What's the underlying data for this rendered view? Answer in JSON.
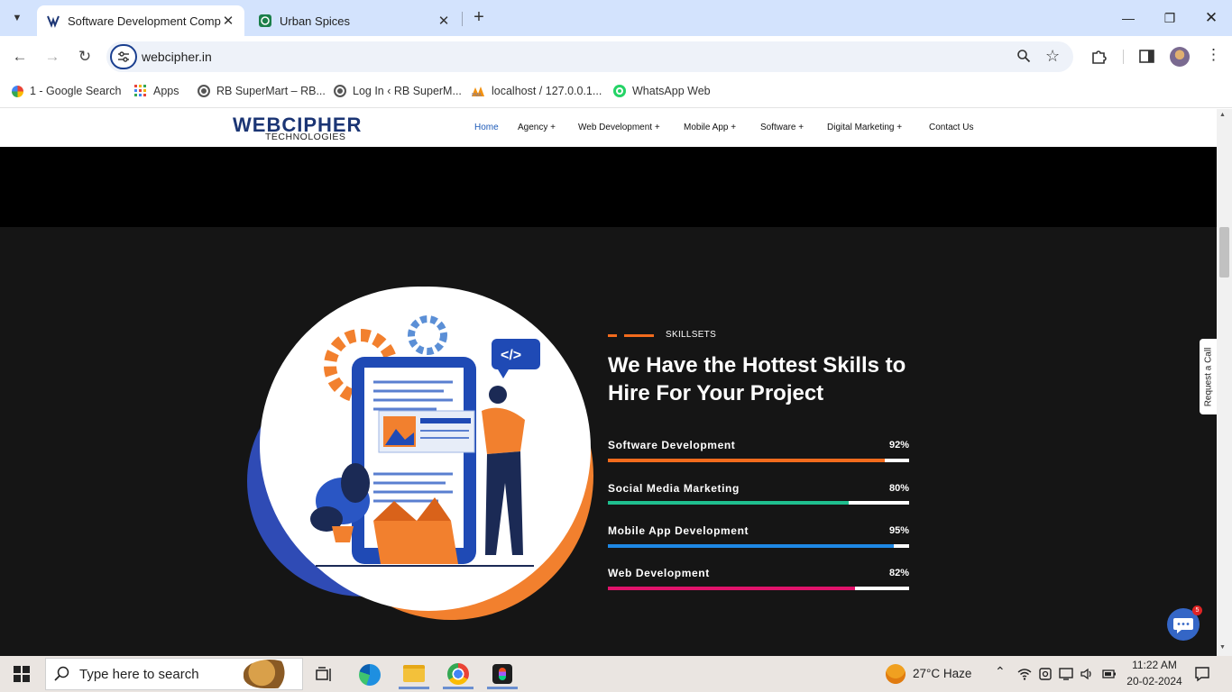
{
  "browser": {
    "tabs": [
      {
        "title": "Software Development Compar",
        "active": true,
        "favicon": "webcipher-favicon"
      },
      {
        "title": "Urban Spices",
        "active": false,
        "favicon": "urban-spices-favicon"
      }
    ],
    "url": "webcipher.in",
    "bookmarks": [
      {
        "label": "1 - Google Search",
        "icon": "google-icon"
      },
      {
        "label": "Apps",
        "icon": "apps-grid-icon"
      },
      {
        "label": "RB SuperMart – RB...",
        "icon": "globe-icon"
      },
      {
        "label": "Log In ‹ RB SuperM...",
        "icon": "globe-icon"
      },
      {
        "label": "localhost / 127.0.0.1...",
        "icon": "phpmyadmin-icon"
      },
      {
        "label": "WhatsApp Web",
        "icon": "whatsapp-icon"
      }
    ]
  },
  "site": {
    "logo_main": "WEBCIPHER",
    "logo_sub": "TECHNOLOGIES",
    "nav": [
      {
        "label": "Home",
        "active": true
      },
      {
        "label": "Agency +"
      },
      {
        "label": "Web Development +"
      },
      {
        "label": "Mobile App +"
      },
      {
        "label": "Software +"
      },
      {
        "label": "Digital Marketing +"
      },
      {
        "label": "Contact Us"
      }
    ],
    "section": {
      "kicker": "SKILLSETS",
      "headline": "We Have the Hottest Skills to Hire For Your Project",
      "skills": [
        {
          "name": "Software Development",
          "pct": "92%",
          "value": 0.92,
          "color": "#f26b1d"
        },
        {
          "name": "Social Media Marketing",
          "pct": "80%",
          "value": 0.8,
          "color": "#1fbf8f"
        },
        {
          "name": "Mobile App Development",
          "pct": "95%",
          "value": 0.95,
          "color": "#1e88e5"
        },
        {
          "name": "Web Development",
          "pct": "82%",
          "value": 0.82,
          "color": "#e0136b"
        }
      ]
    },
    "request_call": "Request a Call",
    "chat_badge": "5"
  },
  "taskbar": {
    "search_placeholder": "Type here to search",
    "weather": "27°C  Haze",
    "time": "11:22 AM",
    "date": "20-02-2024"
  }
}
